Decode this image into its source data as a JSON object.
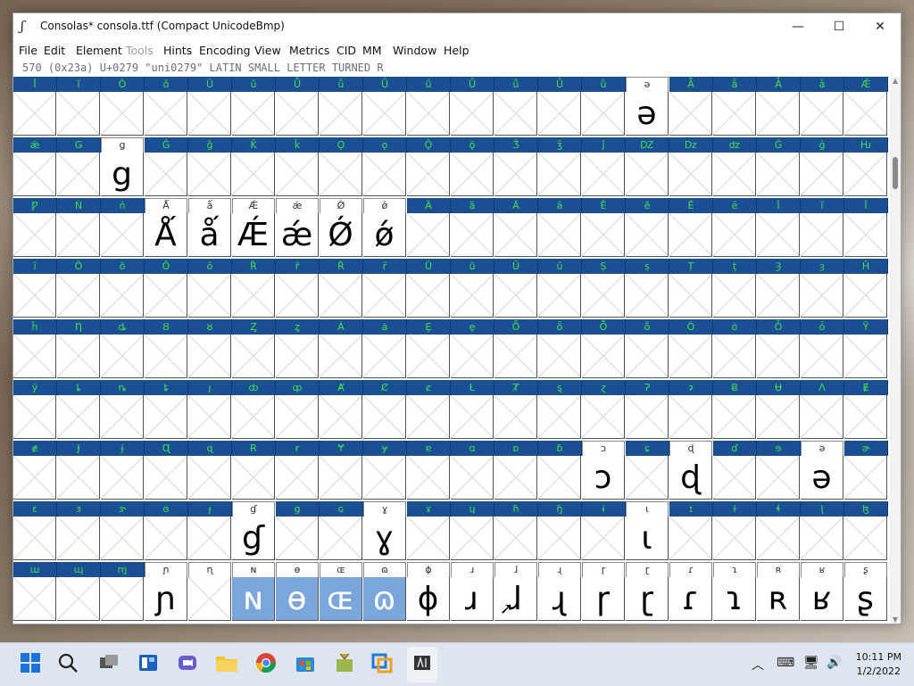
{
  "window": {
    "title": "Consolas* consola.ttf (Compact UnicodeBmp)",
    "minimize": "—",
    "maximize": "☐",
    "close": "✕"
  },
  "menu": [
    "File",
    "Edit",
    "Element",
    "Tools",
    "Hints",
    "Encoding",
    "View",
    "Metrics",
    "CID",
    "MM",
    "Window",
    "Help"
  ],
  "disabled_menu": "Tools",
  "status": "570 (0x23a) U+0279 \"uni0279\" LATIN SMALL LETTER TURNED R",
  "rows": [
    {
      "headers": [
        "Ǐ",
        "ǐ",
        "Ǒ",
        "ǒ",
        "Ǔ",
        "ǔ",
        "Ǖ",
        "ǖ",
        "Ǘ",
        "ǘ",
        "Ǚ",
        "ǚ",
        "Ǜ",
        "ǜ",
        "ǝ",
        "Ǟ",
        "ǟ",
        "Ǡ",
        "ǡ",
        "Ǣ"
      ],
      "glyphs": [
        "",
        "",
        "",
        "",
        "",
        "",
        "",
        "",
        "",
        "",
        "",
        "",
        "",
        "",
        "ə",
        "",
        "",
        "",
        "",
        ""
      ],
      "white": [
        14
      ]
    },
    {
      "headers": [
        "ǣ",
        "Ǥ",
        "ǥ",
        "Ǧ",
        "ǧ",
        "Ǩ",
        "ǩ",
        "Ǫ",
        "ǫ",
        "Ǭ",
        "ǭ",
        "Ǯ",
        "ǯ",
        "ǰ",
        "Ǳ",
        "ǲ",
        "ǳ",
        "Ǵ",
        "ǵ",
        "Ƕ"
      ],
      "glyphs": [
        "",
        "",
        "g",
        "",
        "",
        "",
        "",
        "",
        "",
        "",
        "",
        "",
        "",
        "",
        "",
        "",
        "",
        "",
        "",
        ""
      ],
      "white": [
        2
      ]
    },
    {
      "headers": [
        "Ƿ",
        "Ǹ",
        "ǹ",
        "Ǻ",
        "ǻ",
        "Ǽ",
        "ǽ",
        "Ǿ",
        "ǿ",
        "Ȁ",
        "ȁ",
        "Ȃ",
        "ȃ",
        "Ȅ",
        "ȅ",
        "Ȇ",
        "ȇ",
        "Ȉ",
        "ȉ",
        "Ȋ"
      ],
      "glyphs": [
        "",
        "",
        "",
        "Ǻ",
        "ǻ",
        "Ǽ",
        "ǽ",
        "Ǿ",
        "ǿ",
        "",
        "",
        "",
        "",
        "",
        "",
        "",
        "",
        "",
        "",
        ""
      ],
      "white": [
        3,
        4,
        5,
        6,
        7,
        8
      ]
    },
    {
      "headers": [
        "ȋ",
        "Ȍ",
        "ȍ",
        "Ȏ",
        "ȏ",
        "Ȑ",
        "ȑ",
        "Ȓ",
        "ȓ",
        "Ȕ",
        "ȕ",
        "Ȗ",
        "ȗ",
        "Ș",
        "ș",
        "Ț",
        "ț",
        "Ȝ",
        "ȝ",
        "Ȟ"
      ],
      "glyphs": [
        "",
        "",
        "",
        "",
        "",
        "",
        "",
        "",
        "",
        "",
        "",
        "",
        "",
        "",
        "",
        "",
        "",
        "",
        "",
        ""
      ],
      "white": []
    },
    {
      "headers": [
        "ȟ",
        "Ƞ",
        "ȡ",
        "Ȣ",
        "ȣ",
        "Ȥ",
        "ȥ",
        "Ȧ",
        "ȧ",
        "Ȩ",
        "ȩ",
        "Ȫ",
        "ȫ",
        "Ȭ",
        "ȭ",
        "Ȯ",
        "ȯ",
        "Ȱ",
        "ȱ",
        "Ȳ"
      ],
      "glyphs": [
        "",
        "",
        "",
        "",
        "",
        "",
        "",
        "",
        "",
        "",
        "",
        "",
        "",
        "",
        "",
        "",
        "",
        "",
        "",
        ""
      ],
      "white": []
    },
    {
      "headers": [
        "ȳ",
        "ȴ",
        "ȵ",
        "ȶ",
        "ȷ",
        "ȸ",
        "ȹ",
        "Ⱥ",
        "Ȼ",
        "ȼ",
        "Ƚ",
        "Ⱦ",
        "ȿ",
        "ɀ",
        "Ɂ",
        "ɂ",
        "Ƀ",
        "Ʉ",
        "Ʌ",
        "Ɇ"
      ],
      "glyphs": [
        "",
        "",
        "",
        "",
        "",
        "",
        "",
        "",
        "",
        "",
        "",
        "",
        "",
        "",
        "",
        "",
        "",
        "",
        "",
        ""
      ],
      "white": []
    },
    {
      "headers": [
        "ɇ",
        "Ɉ",
        "ɉ",
        "Ɋ",
        "ɋ",
        "Ɍ",
        "ɍ",
        "Ɏ",
        "ɏ",
        "ɐ",
        "ɑ",
        "ɒ",
        "ɓ",
        "ɔ",
        "ɕ",
        "ɖ",
        "ɗ",
        "ɘ",
        "ə",
        "ɚ"
      ],
      "glyphs": [
        "",
        "",
        "",
        "",
        "",
        "",
        "",
        "",
        "",
        "",
        "",
        "",
        "",
        "ɔ",
        "",
        "ɖ",
        "",
        "",
        "ə",
        ""
      ],
      "white": [
        13,
        15,
        18
      ]
    },
    {
      "headers": [
        "ɛ",
        "ɜ",
        "ɝ",
        "ɞ",
        "ɟ",
        "ɠ",
        "ɡ",
        "ɢ",
        "ɣ",
        "ɤ",
        "ɥ",
        "ɦ",
        "ɧ",
        "ɨ",
        "ɩ",
        "ɪ",
        "ɫ",
        "ɬ",
        "ɭ",
        "ɮ"
      ],
      "glyphs": [
        "",
        "",
        "",
        "",
        "",
        "ɠ",
        "",
        "",
        "ɣ",
        "",
        "",
        "",
        "",
        "",
        "ɩ",
        "",
        "",
        "",
        "",
        ""
      ],
      "white": [
        5,
        8,
        14
      ]
    },
    {
      "headers": [
        "ɯ",
        "ɰ",
        "ɱ",
        "ɲ",
        "ɳ",
        "ɴ",
        "ɵ",
        "ɶ",
        "ɷ",
        "ɸ",
        "ɹ",
        "ɺ",
        "ɻ",
        "ɼ",
        "ɽ",
        "ɾ",
        "ɿ",
        "ʀ",
        "ʁ",
        "ʂ"
      ],
      "glyphs": [
        "",
        "",
        "",
        "ɲ",
        "",
        "ɴ",
        "ɵ",
        "ɶ",
        "ɷ",
        "ɸ",
        "ɹ",
        "ɺ",
        "ɻ",
        "ɼ",
        "ɽ",
        "ɾ",
        "ɿ",
        "ʀ",
        "ʁ",
        "ʂ"
      ],
      "white": [
        3,
        4,
        5,
        6,
        7,
        8,
        9,
        10,
        11,
        12,
        13,
        14,
        15,
        16,
        17,
        18,
        19
      ],
      "selected": [
        5,
        6,
        7,
        8
      ]
    }
  ],
  "taskbar": {
    "time": "10:11 PM",
    "date": "1/2/2022"
  }
}
